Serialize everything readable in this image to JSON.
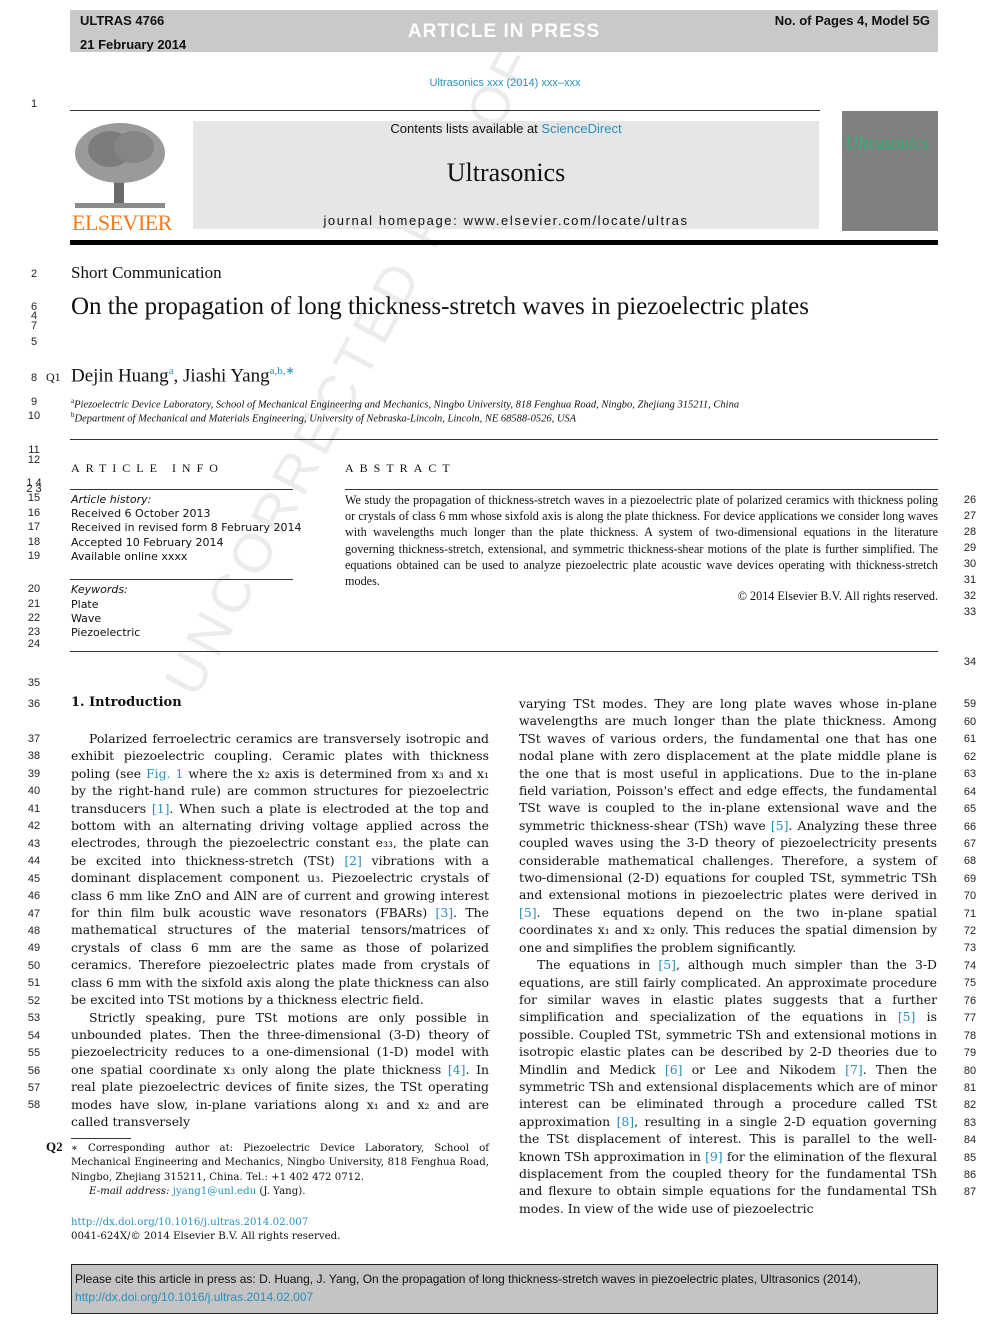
{
  "header": {
    "article_id": "ULTRAS 4766",
    "date": "21 February 2014",
    "status": "ARTICLE IN PRESS",
    "pages_model": "No. of Pages 4, Model 5G",
    "journal_ref": "Ultrasonics xxx (2014) xxx–xxx"
  },
  "masthead": {
    "contents_prefix": "Contents lists available at ",
    "contents_link": "ScienceDirect",
    "journal_title": "Ultrasonics",
    "homepage": "journal homepage: www.elsevier.com/locate/ultras",
    "publisher_logo_text": "ELSEVIER",
    "cover_title": "Ultrasonics"
  },
  "article": {
    "section_type": "Short Communication",
    "title": "On the propagation of long thickness-stretch waves in piezoelectric plates",
    "query_marks": [
      "Q1",
      "Q2"
    ],
    "authors": [
      {
        "name": "Dejin Huang",
        "affil": "a"
      },
      {
        "name": "Jiashi Yang",
        "affil": "a,b,∗"
      }
    ],
    "affiliations": [
      {
        "key": "a",
        "text": "Piezoelectric Device Laboratory, School of Mechanical Engineering and Mechanics, Ningbo University, 818 Fenghua Road, Ningbo, Zhejiang 315211, China"
      },
      {
        "key": "b",
        "text": "Department of Mechanical and Materials Engineering, University of Nebraska-Lincoln, Lincoln, NE 68588-0526, USA"
      }
    ]
  },
  "article_info": {
    "heading": "ARTICLE INFO",
    "history_label": "Article history:",
    "history": [
      "Received 6 October 2013",
      "Received in revised form 8 February 2014",
      "Accepted 10 February 2014",
      "Available online xxxx"
    ],
    "keywords_label": "Keywords:",
    "keywords": [
      "Plate",
      "Wave",
      "Piezoelectric"
    ]
  },
  "abstract": {
    "heading": "ABSTRACT",
    "text": "We study the propagation of thickness-stretch waves in a piezoelectric plate of polarized ceramics with thickness poling or crystals of class 6 mm whose sixfold axis is along the plate thickness. For device applications we consider long waves with wavelengths much longer than the plate thickness. A system of two-dimensional equations in the literature governing thickness-stretch, extensional, and symmetric thickness-shear motions of the plate is further simplified. The equations obtained can be used to analyze piezoelectric plate acoustic wave devices operating with thickness-stretch modes.",
    "copyright": "© 2014 Elsevier B.V. All rights reserved."
  },
  "introduction": {
    "heading": "1. Introduction",
    "left_p1": [
      "Polarized ferroelectric ceramics are transversely isotropic and exhibit piezoelectric coupling. Ceramic plates with thickness poling (see ",
      "Fig. 1",
      " where the x₂ axis is determined from x₃ and x₁ by the right-hand rule) are common structures for piezoelectric transducers ",
      "[1]",
      ". When such a plate is electroded at the top and bottom with an alternating driving voltage applied across the electrodes, through the piezoelectric constant e₃₃, the plate can be excited into thickness-stretch (TSt) ",
      "[2]",
      " vibrations with a dominant displacement component u₃. Piezoelectric crystals of class 6 mm like ZnO and AlN are of current and growing interest for thin film bulk acoustic wave resonators (FBARs) ",
      "[3]",
      ". The mathematical structures of the material tensors/matrices of crystals of class 6 mm are the same as those of polarized ceramics. Therefore piezoelectric plates made from crystals of class 6 mm with the sixfold axis along the plate thickness can also be excited into TSt motions by a thickness electric field."
    ],
    "left_p2": [
      "Strictly speaking, pure TSt motions are only possible in unbounded plates. Then the three-dimensional (3-D) theory of piezoelectricity reduces to a one-dimensional (1-D) model with one spatial coordinate x₃ only along the plate thickness ",
      "[4]",
      ". In real plate piezoelectric devices of finite sizes, the TSt operating modes have slow, in-plane variations along x₁ and x₂ and are called transversely"
    ],
    "right_p1": [
      "varying TSt modes. They are long plate waves whose in-plane wavelengths are much longer than the plate thickness. Among TSt waves of various orders, the fundamental one that has one nodal plane with zero displacement at the plate middle plane is the one that is most useful in applications. Due to the in-plane field variation, Poisson's effect and edge effects, the fundamental TSt wave is coupled to the in-plane extensional wave and the symmetric thickness-shear (TSh) wave ",
      "[5]",
      ". Analyzing these three coupled waves using the 3-D theory of piezoelectricity presents considerable mathematical challenges. Therefore, a system of two-dimensional (2-D) equations for coupled TSt, symmetric TSh and extensional motions in piezoelectric plates were derived in ",
      "[5]",
      ". These equations depend on the two in-plane spatial coordinates x₁ and x₂ only. This reduces the spatial dimension by one and simplifies the problem significantly."
    ],
    "right_p2": [
      "The equations in ",
      "[5]",
      ", although much simpler than the 3-D equations, are still fairly complicated. An approximate procedure for similar waves in elastic plates suggests that a further simplification and specialization of the equations in ",
      "[5]",
      " is possible. Coupled TSt, symmetric TSh and extensional motions in isotropic elastic plates can be described by 2-D theories due to Mindlin and Medick ",
      "[6]",
      " or Lee and Nikodem ",
      "[7]",
      ". Then the symmetric TSh and extensional displacements which are of minor interest can be eliminated through a procedure called TSt approximation ",
      "[8]",
      ", resulting in a single 2-D equation governing the TSt displacement of interest. This is parallel to the well-known TSh approximation in ",
      "[9]",
      " for the elimination of the flexural displacement from the coupled theory for the fundamental TSh and flexure to obtain simple equations for the fundamental TSh modes. In view of the wide use of piezoelectric"
    ]
  },
  "footnote": {
    "text": "∗ Corresponding author at: Piezoelectric Device Laboratory, School of Mechanical Engineering and Mechanics, Ningbo University, 818 Fenghua Road, Ningbo, Zhejiang 315211, China. Tel.: +1 402 472 0712.",
    "email_label": "E-mail address: ",
    "email": "jyang1@unl.edu",
    "email_suffix": " (J. Yang).",
    "doi": "http://dx.doi.org/10.1016/j.ultras.2014.02.007",
    "issn": "0041-624X/© 2014 Elsevier B.V. All rights reserved."
  },
  "citation": {
    "prefix": "Please cite this article in press as: D. Huang, J. Yang, On the propagation of long thickness-stretch waves in piezoelectric plates, Ultrasonics (2014), ",
    "link": "http://dx.doi.org/10.1016/j.ultras.2014.02.007"
  },
  "watermark": "UNCORRECTED PROOF",
  "line_numbers": {
    "left": [
      "1",
      "2",
      "6",
      "4",
      "7",
      "5",
      "8",
      "9",
      "10",
      "11",
      "12",
      "1 4",
      "2 3",
      "15",
      "16",
      "17",
      "18",
      "19",
      "20",
      "21",
      "22",
      "23",
      "24",
      "35",
      "36",
      "37",
      "38",
      "39",
      "40",
      "41",
      "42",
      "43",
      "44",
      "45",
      "46",
      "47",
      "48",
      "49",
      "50",
      "51",
      "52",
      "53",
      "54",
      "55",
      "56",
      "57",
      "58"
    ],
    "right": [
      "26",
      "27",
      "28",
      "29",
      "30",
      "31",
      "32",
      "33",
      "34",
      "59",
      "60",
      "61",
      "62",
      "63",
      "64",
      "65",
      "66",
      "67",
      "68",
      "69",
      "70",
      "71",
      "72",
      "73",
      "74",
      "75",
      "76",
      "77",
      "78",
      "79",
      "80",
      "81",
      "82",
      "83",
      "84",
      "85",
      "86",
      "87"
    ]
  }
}
